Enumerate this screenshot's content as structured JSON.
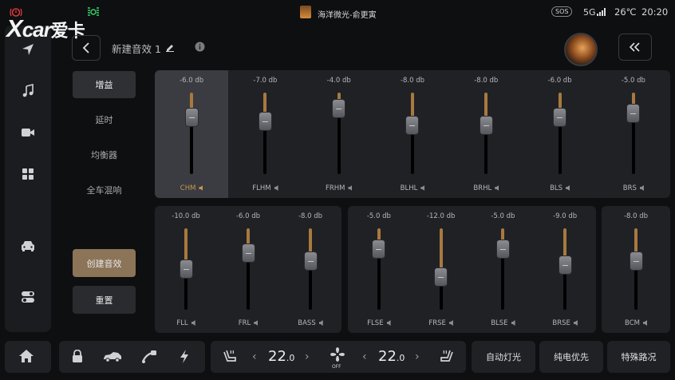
{
  "status": {
    "now_playing": "海洋微光-俞更寅",
    "sos": "SOS",
    "network": "5G",
    "temperature": "26℃",
    "time": "20:20"
  },
  "watermark": "爱卡",
  "header": {
    "title": "新建音效 1"
  },
  "menu": [
    {
      "label": "增益",
      "active": true
    },
    {
      "label": "延时",
      "active": false
    },
    {
      "label": "均衡器",
      "active": false
    },
    {
      "label": "全车混响",
      "active": false
    }
  ],
  "actions": {
    "create": "创建音效",
    "reset": "重置"
  },
  "colors": {
    "accent": "#a8793f",
    "selected_label": "#c89550",
    "create_button": "#8b7457"
  },
  "channels_top": [
    {
      "name": "CHM",
      "db": "-6.0 db",
      "value": -6.0,
      "selected": true
    },
    {
      "name": "FLHM",
      "db": "-7.0 db",
      "value": -7.0
    },
    {
      "name": "FRHM",
      "db": "-4.0 db",
      "value": -4.0
    },
    {
      "name": "BLHL",
      "db": "-8.0 db",
      "value": -8.0
    },
    {
      "name": "BRHL",
      "db": "-8.0 db",
      "value": -8.0
    },
    {
      "name": "BLS",
      "db": "-6.0 db",
      "value": -6.0
    },
    {
      "name": "BRS",
      "db": "-5.0 db",
      "value": -5.0
    }
  ],
  "channels_front": [
    {
      "name": "FLL",
      "db": "-10.0 db",
      "value": -10.0
    },
    {
      "name": "FRL",
      "db": "-6.0 db",
      "value": -6.0
    },
    {
      "name": "BASS",
      "db": "-8.0 db",
      "value": -8.0
    }
  ],
  "channels_rear": [
    {
      "name": "FLSE",
      "db": "-5.0 db",
      "value": -5.0
    },
    {
      "name": "FRSE",
      "db": "-12.0 db",
      "value": -12.0
    },
    {
      "name": "BLSE",
      "db": "-5.0 db",
      "value": -5.0
    },
    {
      "name": "BRSE",
      "db": "-9.0 db",
      "value": -9.0
    }
  ],
  "channels_center": [
    {
      "name": "BCM",
      "db": "-8.0 db",
      "value": -8.0
    }
  ],
  "climate": {
    "left_temp": "22",
    "left_temp_decimal": ".0",
    "right_temp": "22",
    "right_temp_decimal": ".0",
    "fan_state": "OFF"
  },
  "quick_buttons": {
    "auto_light": "自动灯光",
    "ev_priority": "纯电优先",
    "special_road": "特殊路况"
  },
  "icons": [
    "home-icon",
    "lock-icon",
    "car-side-icon",
    "charging-port-icon",
    "bolt-icon",
    "seat-heat-icon",
    "fan-icon",
    "music-icon",
    "video-icon",
    "apps-icon",
    "car-front-icon",
    "toggle-icon",
    "edit-icon",
    "info-icon",
    "collapse-icon",
    "back-icon"
  ]
}
